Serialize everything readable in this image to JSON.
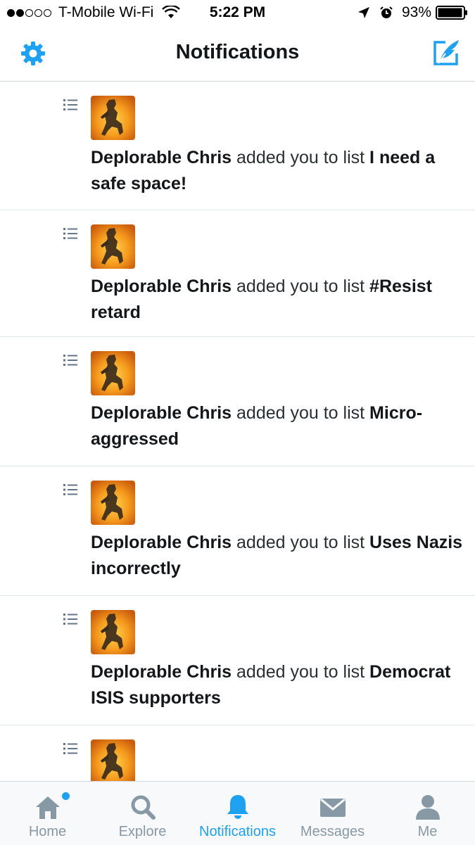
{
  "status_bar": {
    "carrier": "T-Mobile Wi-Fi",
    "time": "5:22 PM",
    "battery": "93%",
    "signal_bars_filled": 2,
    "signal_bars_total": 5
  },
  "nav": {
    "title": "Notifications",
    "left_icon": "gear-icon",
    "right_icon": "compose-icon",
    "accent": "#1da1f2"
  },
  "notifications": [
    {
      "user": "Deplorable Chris",
      "action": "added you to list",
      "list_name": "I need a safe space!"
    },
    {
      "user": "Deplorable Chris",
      "action": "added you to list",
      "list_name": "#Resist retard"
    },
    {
      "user": "Deplorable Chris",
      "action": "added you to list",
      "list_name": "Micro-aggressed"
    },
    {
      "user": "Deplorable Chris",
      "action": "added you to list",
      "list_name": "Uses Nazis incorrectly"
    },
    {
      "user": "Deplorable Chris",
      "action": "added you to list",
      "list_name": "Democrat ISIS supporters"
    },
    {
      "user": "",
      "action": "",
      "list_name": ""
    }
  ],
  "tabs": [
    {
      "label": "Home",
      "icon": "home-icon",
      "active": false,
      "badge": true
    },
    {
      "label": "Explore",
      "icon": "search-icon",
      "active": false
    },
    {
      "label": "Notifications",
      "icon": "bell-icon",
      "active": true
    },
    {
      "label": "Messages",
      "icon": "envelope-icon",
      "active": false
    },
    {
      "label": "Me",
      "icon": "person-icon",
      "active": false
    }
  ]
}
